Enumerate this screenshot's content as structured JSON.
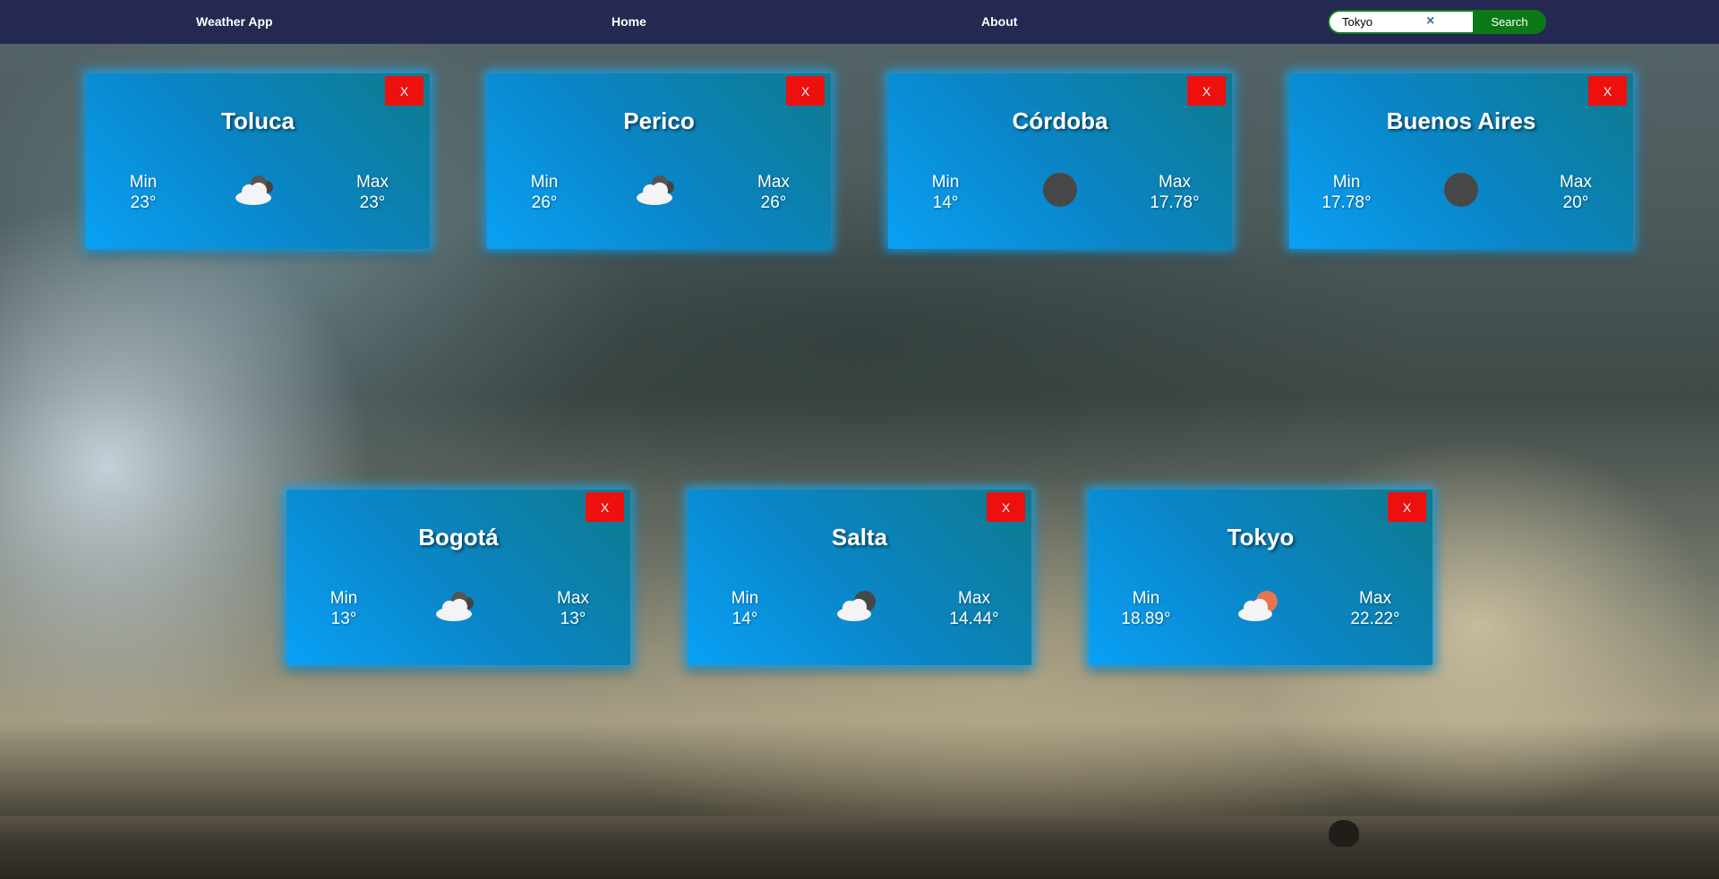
{
  "nav": {
    "brand": "Weather App",
    "home": "Home",
    "about": "About"
  },
  "search": {
    "value": "Tokyo",
    "clear": "×",
    "button": "Search"
  },
  "cards": [
    {
      "city": "Toluca",
      "min_label": "Min",
      "min": "23°",
      "max_label": "Max",
      "max": "23°",
      "icon": "broken-clouds-icon",
      "close": "X"
    },
    {
      "city": "Perico",
      "min_label": "Min",
      "min": "26°",
      "max_label": "Max",
      "max": "26°",
      "icon": "broken-clouds-icon",
      "close": "X"
    },
    {
      "city": "Córdoba",
      "min_label": "Min",
      "min": "14°",
      "max_label": "Max",
      "max": "17.78°",
      "icon": "clear-night-icon",
      "close": "X"
    },
    {
      "city": "Buenos Aires",
      "min_label": "Min",
      "min": "17.78°",
      "max_label": "Max",
      "max": "20°",
      "icon": "clear-night-icon",
      "close": "X"
    },
    {
      "city": "Bogotá",
      "min_label": "Min",
      "min": "13°",
      "max_label": "Max",
      "max": "13°",
      "icon": "broken-clouds-icon",
      "close": "X"
    },
    {
      "city": "Salta",
      "min_label": "Min",
      "min": "14°",
      "max_label": "Max",
      "max": "14.44°",
      "icon": "few-clouds-night-icon",
      "close": "X"
    },
    {
      "city": "Tokyo",
      "min_label": "Min",
      "min": "18.89°",
      "max_label": "Max",
      "max": "22.22°",
      "icon": "few-clouds-day-icon",
      "close": "X"
    }
  ],
  "colors": {
    "topbar": "#252850",
    "close_button": "#ee0f0f",
    "search_button": "#0b7a16",
    "card_from": "#0aa0f5",
    "card_to": "#0e7a8e"
  }
}
